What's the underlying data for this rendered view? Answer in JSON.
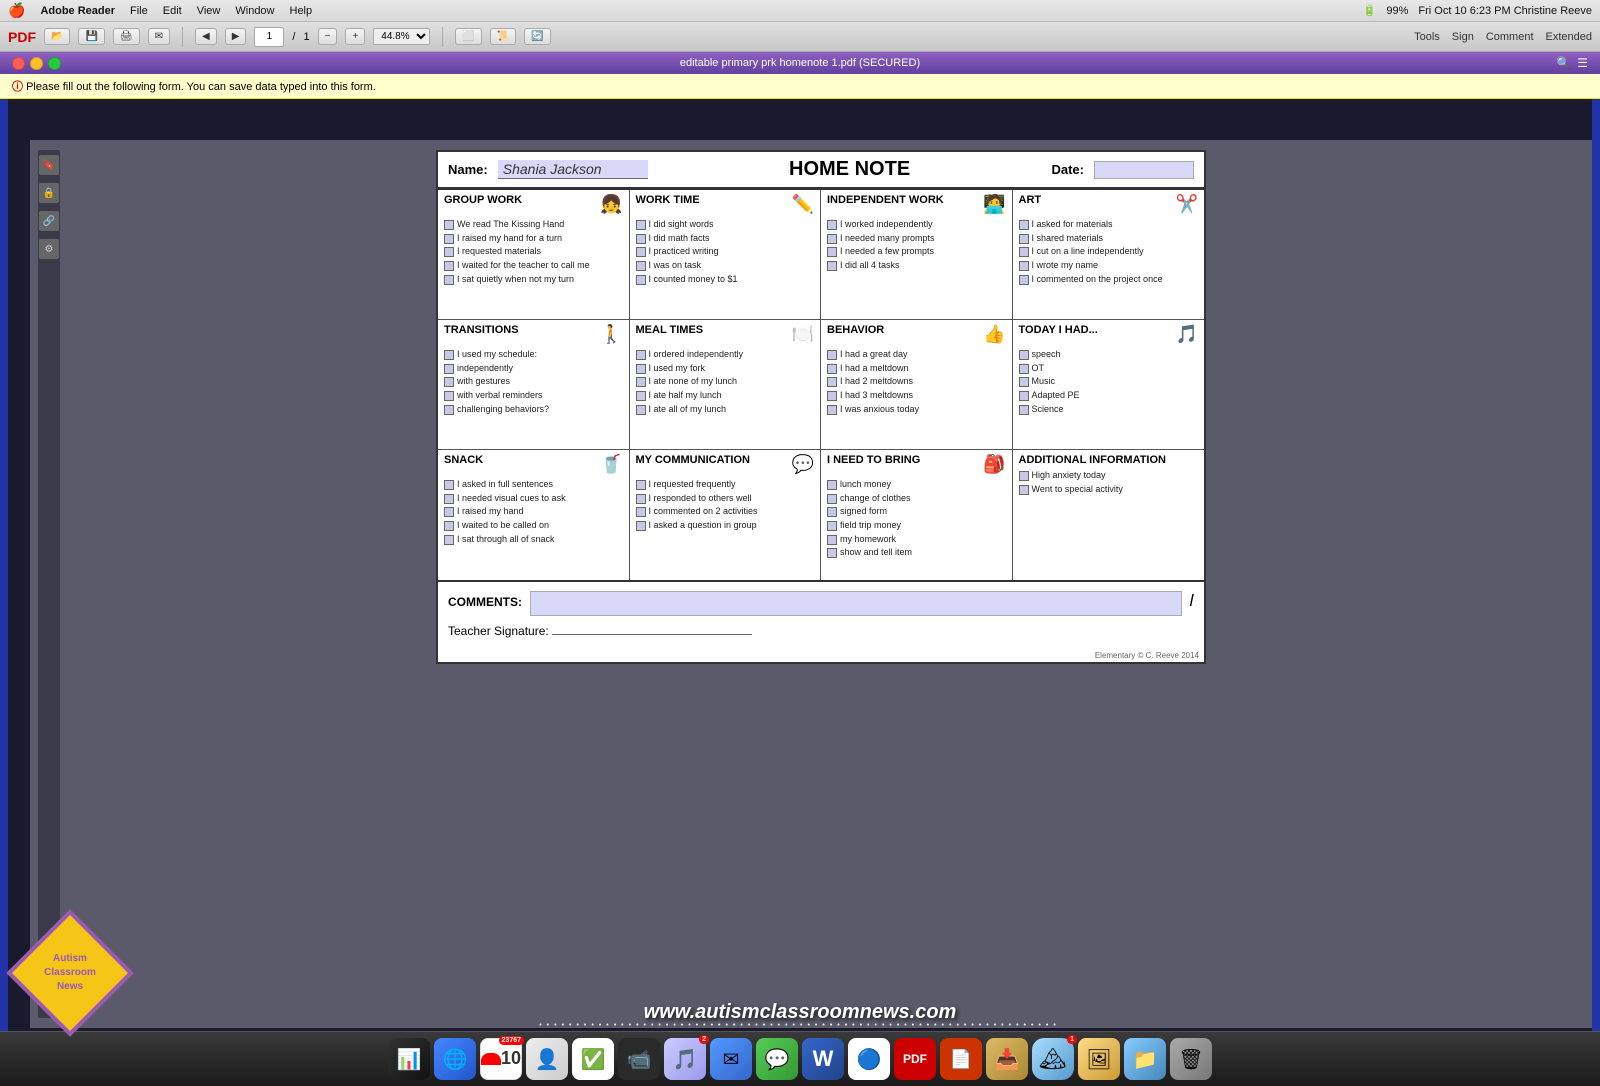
{
  "window": {
    "title": "editable primary prk homenote 1.pdf (SECURED)",
    "zoom": "44.8%",
    "page_current": "1",
    "page_total": "1"
  },
  "mac_menubar": {
    "app": "Adobe Reader",
    "menus": [
      "File",
      "Edit",
      "View",
      "Window",
      "Help"
    ],
    "right": "Fri Oct 10  6:23 PM  Christine Reeve",
    "battery": "99%"
  },
  "toolbar": {
    "tools": "Tools",
    "sign": "Sign",
    "comment": "Comment",
    "extended": "Extended"
  },
  "notice": "Please fill out the following form. You can save data typed into this form.",
  "home_note": {
    "name_label": "Name:",
    "name_value": "Shania Jackson",
    "title": "HOME NOTE",
    "date_label": "Date:",
    "sections": {
      "group_work": {
        "header": "GROUP WORK",
        "items": [
          "We read The Kissing Hand",
          "I raised my hand for a turn",
          "I requested materials",
          "I waited for the teacher to call me",
          "I sat quietly when not my turn"
        ]
      },
      "work_time": {
        "header": "WORK TIME",
        "items": [
          "I did sight words",
          "I did math facts",
          "I practiced writing",
          "I was on task",
          "I counted money to $1"
        ]
      },
      "independent_work": {
        "header": "INDEPENDENT WORK",
        "items": [
          "I worked independently",
          "I needed many prompts",
          "I needed a few prompts",
          "I did all 4 tasks"
        ]
      },
      "art": {
        "header": "ART",
        "items": [
          "I asked for materials",
          "I shared materials",
          "I cut on a line independently",
          "I wrote my name",
          "I commented on the project once"
        ]
      },
      "transitions": {
        "header": "TRANSITIONS",
        "items": [
          "I used my schedule:",
          "independently",
          "with gestures",
          "with verbal reminders",
          "challenging behaviors?"
        ]
      },
      "meal_times": {
        "header": "MEAL TIMES",
        "items": [
          "I ordered independently",
          "I used my fork",
          "I ate none of my lunch",
          "I ate half my lunch",
          "I ate all of my lunch"
        ]
      },
      "behavior": {
        "header": "BEHAVIOR",
        "items": [
          "I had a great day",
          "I had a meltdown",
          "I had 2 meltdowns",
          "I had 3 meltdowns",
          "I was anxious today"
        ]
      },
      "today_i_had": {
        "header": "TODAY I HAD...",
        "items": [
          "speech",
          "OT",
          "Music",
          "Adapted PE",
          "Science"
        ]
      },
      "snack": {
        "header": "SNACK",
        "items": [
          "I asked in full sentences",
          "I needed visual cues to ask",
          "I raised my hand",
          "I waited to be called on",
          "I sat through all of snack"
        ]
      },
      "my_communication": {
        "header": "MY COMMUNICATION",
        "items": [
          "I requested frequently",
          "I responded to others well",
          "I commented on 2 activities",
          "I asked a question in group"
        ]
      },
      "i_need_to_bring": {
        "header": "I NEED TO BRING",
        "items": [
          "lunch money",
          "change of clothes",
          "signed form",
          "field trip money",
          "my homework",
          "show and tell item"
        ]
      },
      "additional_info": {
        "header": "ADDITIONAL INFORMATION",
        "items": [
          "High anxiety today",
          "Went to special activity"
        ]
      }
    },
    "comments_label": "COMMENTS:",
    "signature_label": "Teacher Signature:",
    "footer": "Elementary     © C. Reeve 2014"
  },
  "autism_logo": {
    "line1": "Autism",
    "line2": "Classroom",
    "line3": "News"
  },
  "website": "www.autismclassroomnews.com",
  "dock_icons": [
    "📊",
    "🌐",
    "📅",
    "🎵",
    "🖊",
    "📁",
    "✉",
    "🎵",
    "💬",
    "W",
    "🔵",
    "📄",
    "🔴",
    "🗂",
    "🏔",
    "🎨",
    "📦",
    "🗑"
  ]
}
